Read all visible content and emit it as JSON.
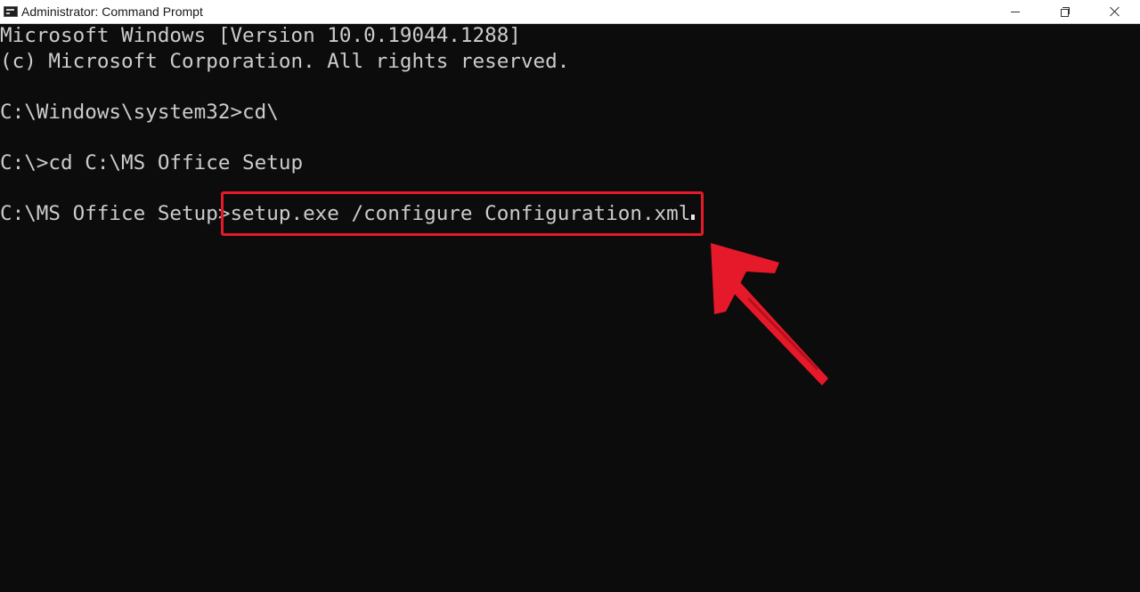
{
  "window": {
    "title": "Administrator: Command Prompt",
    "icon": "cmd-icon",
    "controls": {
      "minimize": "minimize-icon",
      "restore": "restore-icon",
      "close": "close-icon"
    }
  },
  "console": {
    "lines": [
      "Microsoft Windows [Version 10.0.19044.1288]",
      "(c) Microsoft Corporation. All rights reserved.",
      "",
      "C:\\Windows\\system32>cd\\",
      "",
      "C:\\>cd C:\\MS Office Setup",
      "",
      "C:\\MS Office Setup>setup.exe /configure Configuration.xml"
    ],
    "prompt": "C:\\MS Office Setup>",
    "current_command": "setup.exe /configure Configuration.xml"
  },
  "annotation": {
    "highlight_color": "#e5192a",
    "arrow_color": "#e5192a"
  }
}
